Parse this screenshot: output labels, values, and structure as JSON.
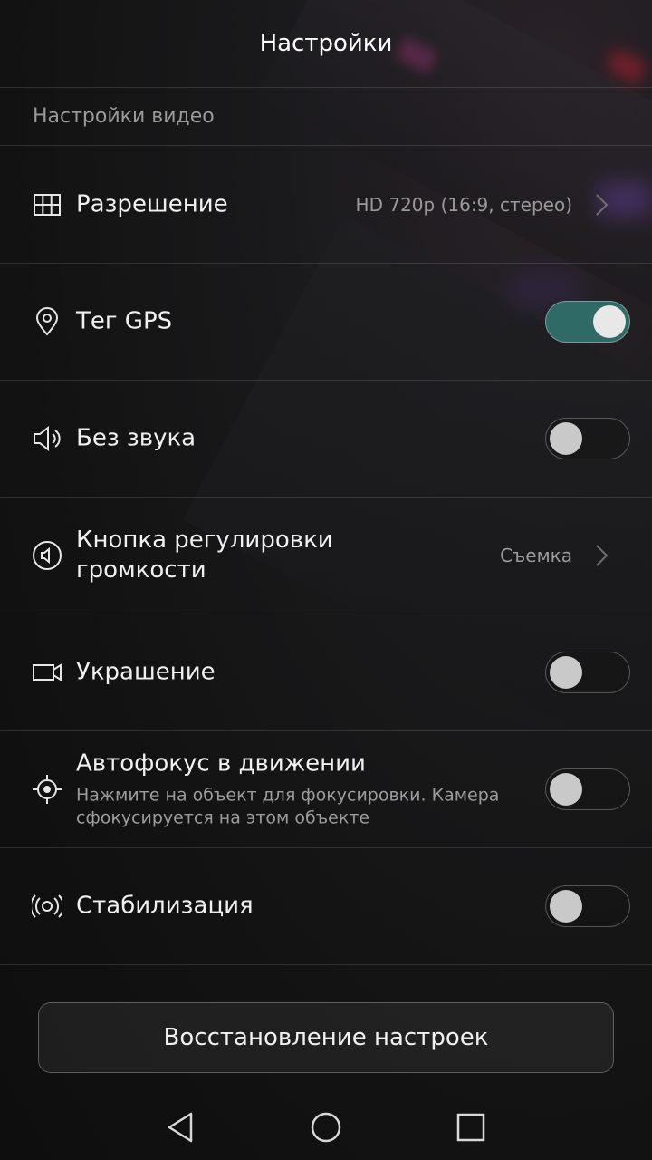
{
  "header": {
    "title": "Настройки"
  },
  "section": {
    "title": "Настройки видео"
  },
  "rows": {
    "resolution": {
      "label": "Разрешение",
      "value": "HD 720p (16:9, стерео)",
      "icon": "grid-icon"
    },
    "gps": {
      "label": "Тег GPS",
      "toggle": true,
      "icon": "location-pin-icon"
    },
    "mute": {
      "label": "Без звука",
      "toggle": false,
      "icon": "speaker-icon"
    },
    "volume_key": {
      "label_line1": "Кнопка регулировки",
      "label_line2": "громкости",
      "value": "Съемка",
      "icon": "volume-circle-icon"
    },
    "beauty": {
      "label": "Украшение",
      "toggle": false,
      "icon": "video-camera-icon"
    },
    "autofocus": {
      "label": "Автофокус в движении",
      "sub": "Нажмите на объект для фокусировки. Камера сфокусируется на этом объекте",
      "toggle": false,
      "icon": "focus-target-icon"
    },
    "stabilization": {
      "label": "Стабилизация",
      "toggle": false,
      "icon": "stabilization-icon"
    }
  },
  "reset_button": {
    "label": "Восстановление настроек"
  },
  "navbar": {
    "back": "back-icon",
    "home": "home-icon",
    "recents": "recents-icon"
  },
  "colors": {
    "toggle_on": "#2f6a66",
    "background": "#161616",
    "text": "#f0f0f0",
    "secondary": "#9a9a9a"
  }
}
